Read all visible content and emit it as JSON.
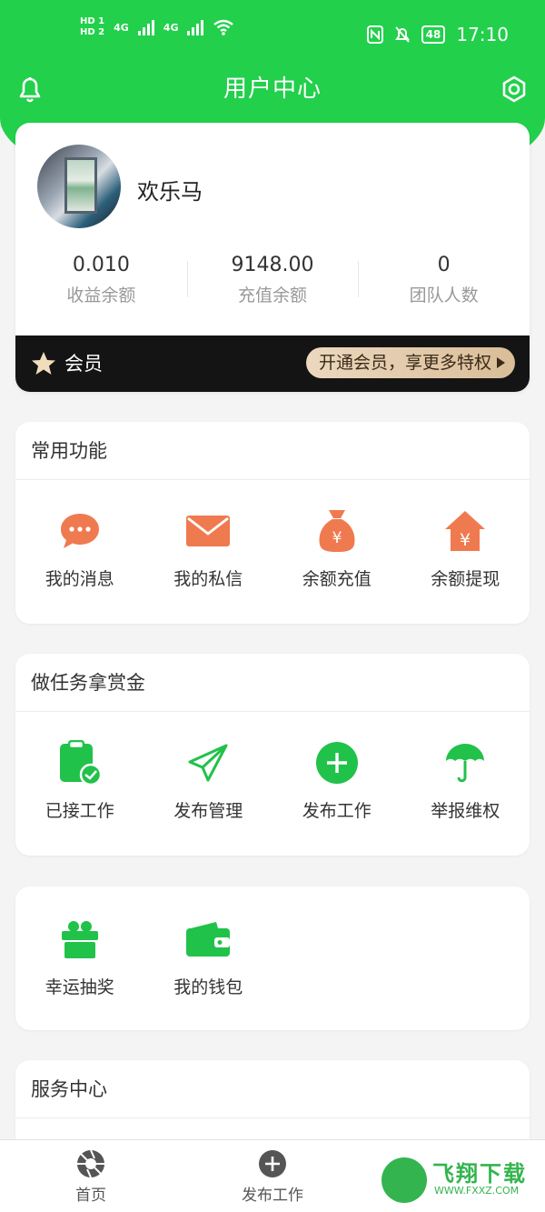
{
  "status_bar": {
    "hd1": "HD 1",
    "hd2": "HD 2",
    "net1": "4G",
    "net2": "4G",
    "battery": "48",
    "time": "17:10"
  },
  "header": {
    "title": "用户中心"
  },
  "profile": {
    "username": "欢乐马",
    "stats": [
      {
        "value": "0.010",
        "label": "收益余额"
      },
      {
        "value": "9148.00",
        "label": "充值余额"
      },
      {
        "value": "0",
        "label": "团队人数"
      }
    ],
    "vip_label": "会员",
    "vip_button": "开通会员，享更多特权"
  },
  "common_functions": {
    "title": "常用功能",
    "items": [
      {
        "label": "我的消息",
        "icon": "chat-bubble-icon"
      },
      {
        "label": "我的私信",
        "icon": "envelope-icon"
      },
      {
        "label": "余额充值",
        "icon": "money-bag-icon"
      },
      {
        "label": "余额提现",
        "icon": "house-yen-icon"
      }
    ]
  },
  "tasks": {
    "title": "做任务拿赏金",
    "items": [
      {
        "label": "已接工作",
        "icon": "clipboard-icon"
      },
      {
        "label": "发布管理",
        "icon": "paper-plane-icon"
      },
      {
        "label": "发布工作",
        "icon": "plus-circle-icon"
      },
      {
        "label": "举报维权",
        "icon": "umbrella-icon"
      }
    ]
  },
  "extras": {
    "items": [
      {
        "label": "幸运抽奖",
        "icon": "gift-icon"
      },
      {
        "label": "我的钱包",
        "icon": "wallet-icon"
      }
    ]
  },
  "service": {
    "title": "服务中心"
  },
  "tabbar": {
    "items": [
      {
        "label": "首页",
        "icon": "camera-shutter-icon"
      },
      {
        "label": "发布工作",
        "icon": "plus-circle-icon"
      }
    ]
  },
  "watermark": {
    "text": "飞翔下载",
    "url": "WWW.FXXZ.COM"
  },
  "colors": {
    "primary_green": "#22d04b",
    "orange_icon": "#f07a4f",
    "vip_gold": "#e4ccab",
    "vip_bar": "#141414"
  }
}
